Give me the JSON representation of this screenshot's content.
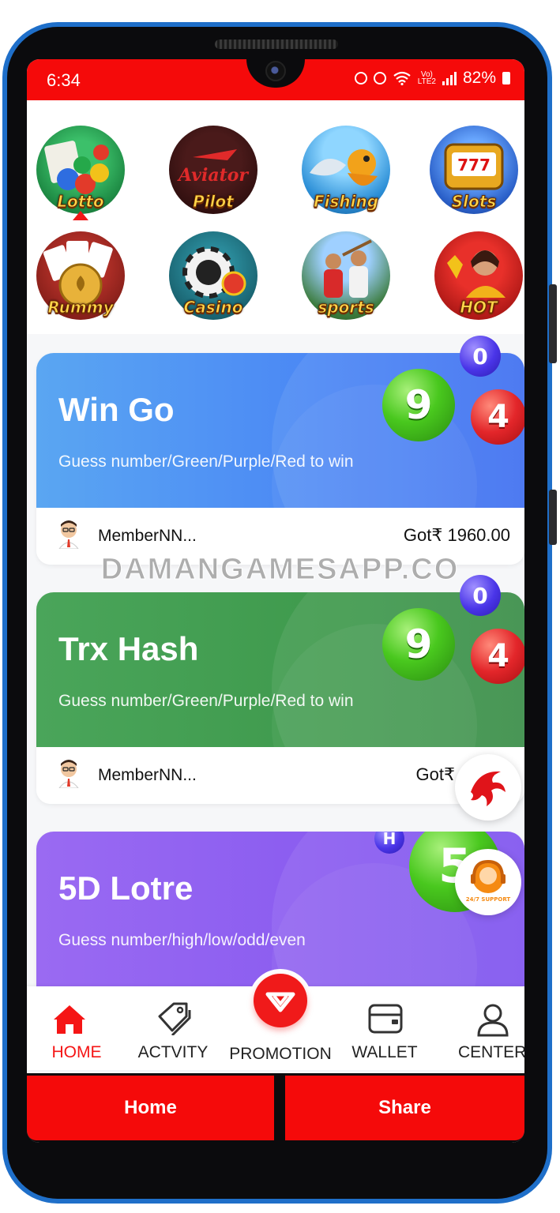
{
  "status_bar": {
    "time": "6:34",
    "volte": "Vo)",
    "lte": "LTE2",
    "battery": "82%"
  },
  "games": [
    {
      "label": "Lotto",
      "icon": "lotto-balls-icon"
    },
    {
      "label": "Pilot",
      "icon": "aviator-plane-icon"
    },
    {
      "label": "Fishing",
      "icon": "fishing-icon"
    },
    {
      "label": "Slots",
      "icon": "slot-machine-icon"
    },
    {
      "label": "Rummy",
      "icon": "playing-cards-icon"
    },
    {
      "label": "Casino",
      "icon": "poker-chip-icon"
    },
    {
      "label": "sports",
      "icon": "sports-players-icon"
    },
    {
      "label": "HOT",
      "icon": "hot-games-icon"
    }
  ],
  "pilot_logo_text": "Aviator",
  "cards": [
    {
      "title": "Win Go",
      "subtitle": "Guess number/Green/Purple/Red to win",
      "member": "MemberNN...",
      "amount": "Got₹ 1960.00",
      "balls": [
        "9",
        "4",
        "0"
      ]
    },
    {
      "title": "Trx Hash",
      "subtitle": "Guess number/Green/Purple/Red to win",
      "member": "MemberNN...",
      "amount": "Got₹",
      "balls": [
        "9",
        "4",
        "0"
      ]
    },
    {
      "title": "5D Lotre",
      "subtitle": "Guess number/high/low/odd/even",
      "balls": [
        "5",
        "H"
      ]
    }
  ],
  "watermark": "DAMANGAMESAPP.CO",
  "support_label": "24/7 SUPPORT",
  "tabs": [
    {
      "label": "HOME",
      "icon": "home-icon"
    },
    {
      "label": "ACTVITY",
      "icon": "tag-icon"
    },
    {
      "label": "PROMOTION",
      "icon": "diamond-icon"
    },
    {
      "label": "WALLET",
      "icon": "wallet-icon"
    },
    {
      "label": "CENTER",
      "icon": "user-icon"
    }
  ],
  "bottom_buttons": {
    "home": "Home",
    "share": "Share"
  },
  "colors": {
    "brand_red": "#f50a0a",
    "frame_blue": "#1f6fc9",
    "wingo_blue": "#4a8ef5",
    "trx_green": "#3f9a4d",
    "lotre_purple": "#8a5cf0"
  }
}
